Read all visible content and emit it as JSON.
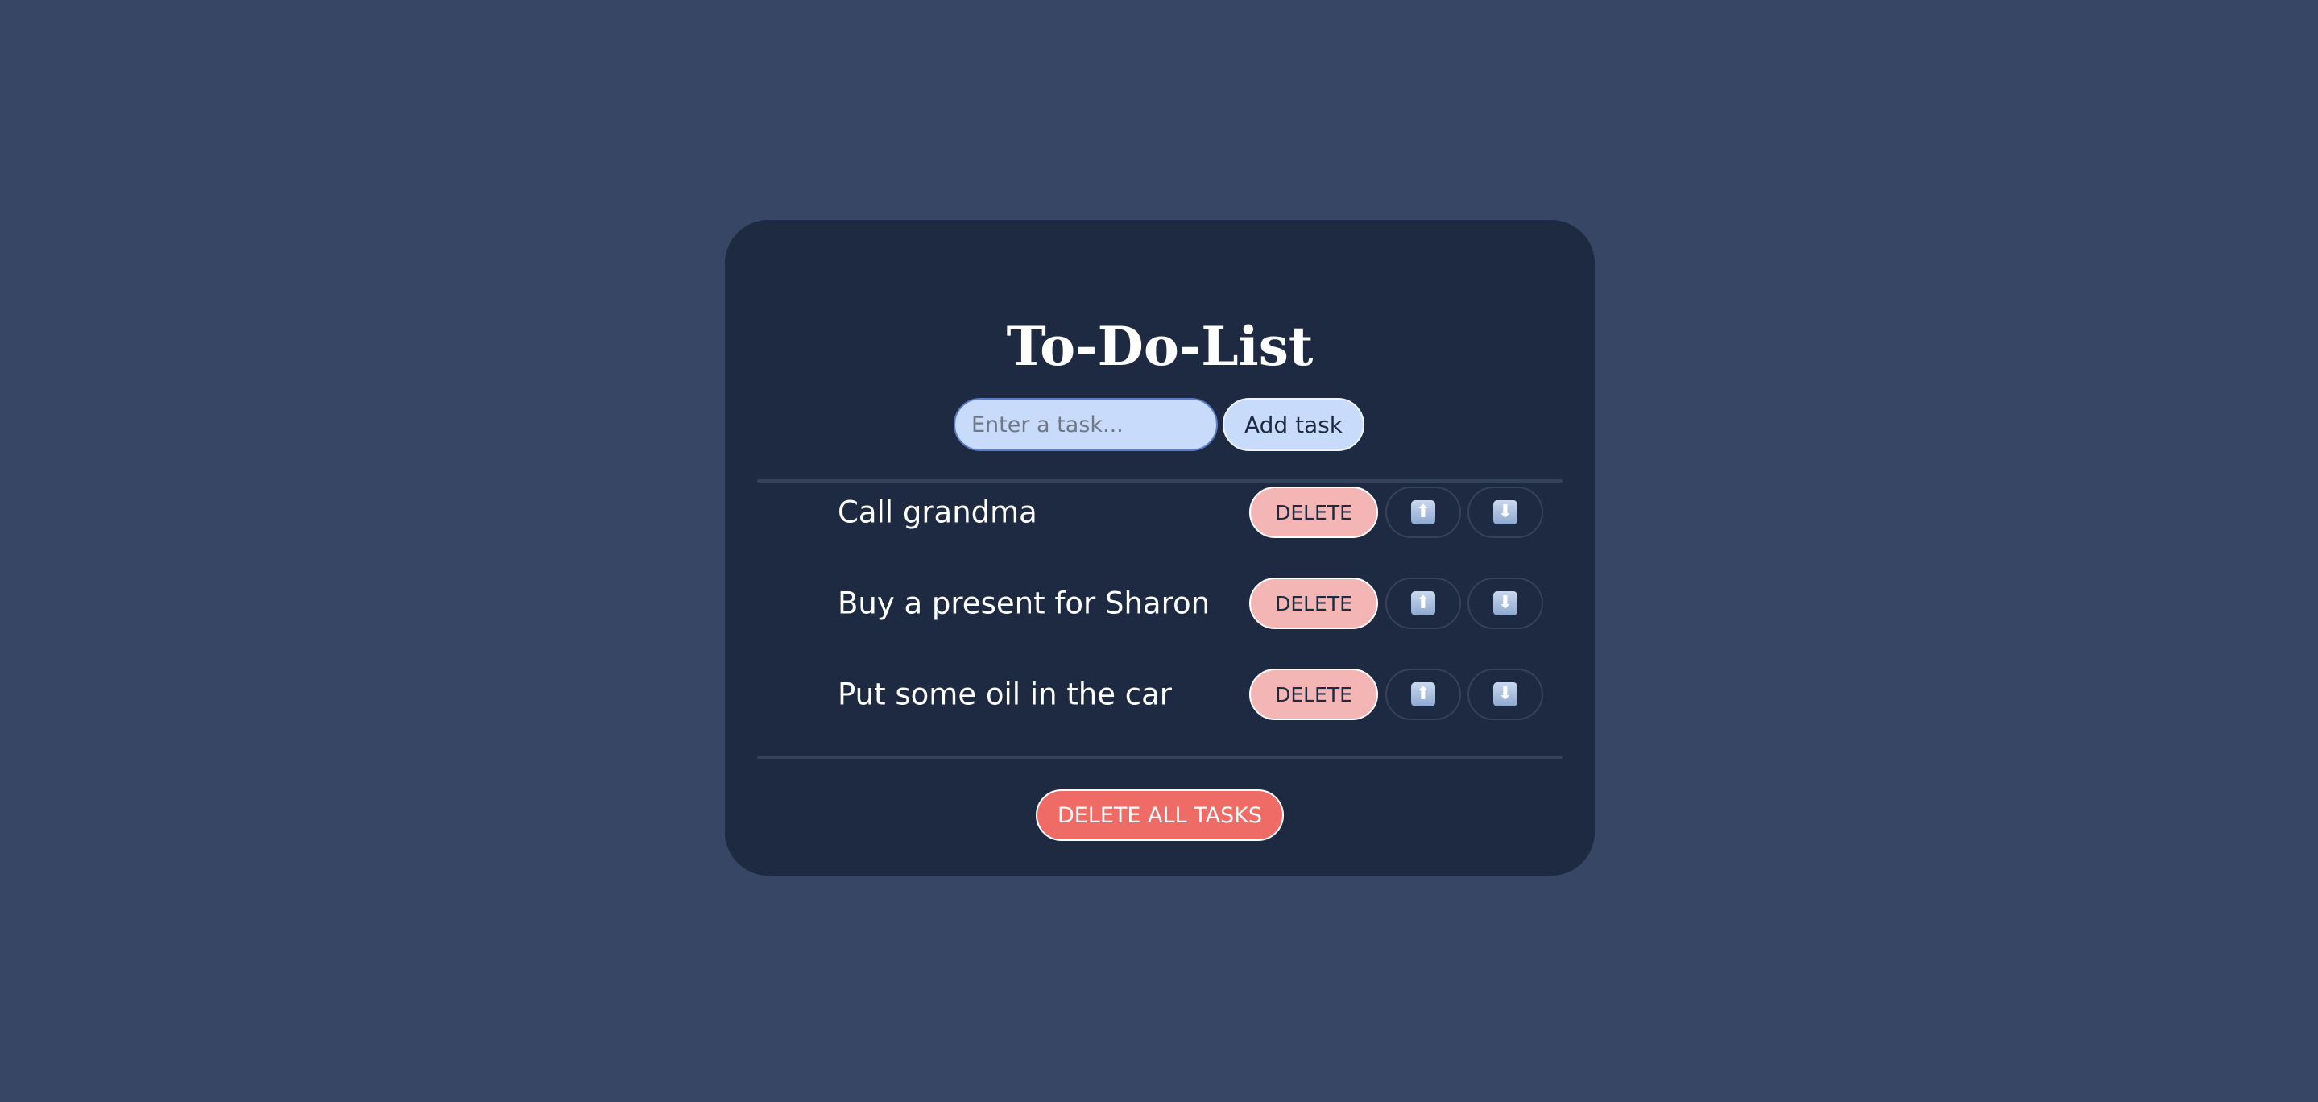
{
  "header": {
    "title": "To-Do-List"
  },
  "input": {
    "placeholder": "Enter a task...",
    "value": ""
  },
  "toolbar": {
    "add_label": "Add task"
  },
  "tasks": [
    {
      "text": "Call grandma",
      "delete_label": "DELETE",
      "up_icon": "up-arrow-icon",
      "down_icon": "down-arrow-icon"
    },
    {
      "text": "Buy a present for Sharon",
      "delete_label": "DELETE",
      "up_icon": "up-arrow-icon",
      "down_icon": "down-arrow-icon"
    },
    {
      "text": "Put some oil in the car",
      "delete_label": "DELETE",
      "up_icon": "up-arrow-icon",
      "down_icon": "down-arrow-icon"
    }
  ],
  "footer": {
    "delete_all_label": "DELETE ALL TASKS"
  },
  "colors": {
    "page_background": "#364664",
    "card_background": "#1e2a42",
    "input_background": "#c8dbfb",
    "delete_button": "#f3b6b5",
    "delete_all_button": "#ef6b66"
  }
}
